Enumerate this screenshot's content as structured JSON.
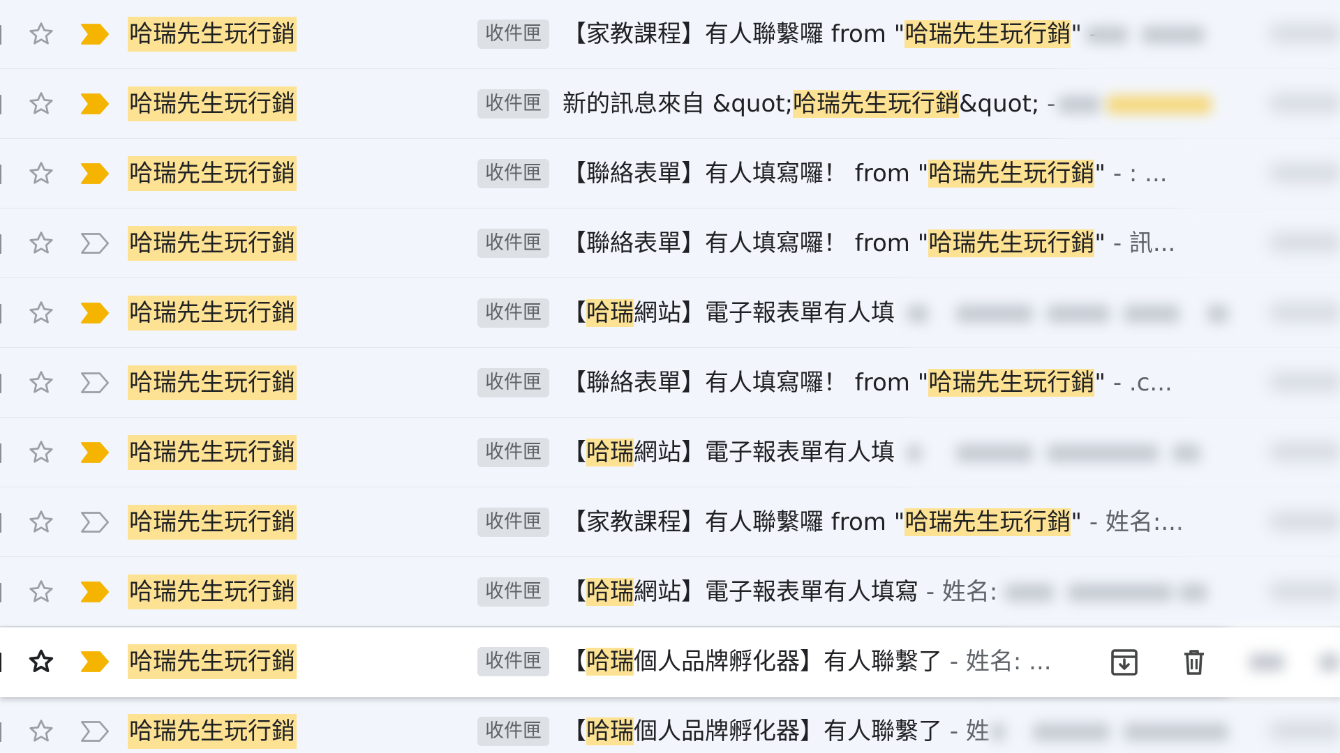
{
  "colors": {
    "highlight": "#fde293",
    "important_marker": "#f4b400",
    "label_chip_bg": "#dde1e6"
  },
  "rows": [
    {
      "sender": "哈瑞先生玩行銷",
      "label": "收件匣",
      "subject_prefix": "【家教課程】有人聯繫囉 from \"",
      "subject_highlight": "哈瑞先生玩行銷",
      "subject_suffix": "\"",
      "snippet": " - ",
      "important": "filled",
      "starred": false
    },
    {
      "sender": "哈瑞先生玩行銷",
      "label": "收件匣",
      "subject_prefix": "新的訊息來自 &quot;",
      "subject_highlight": "哈瑞先生玩行銷",
      "subject_suffix": "&quot;",
      "snippet": " - ",
      "important": "filled",
      "starred": false
    },
    {
      "sender": "哈瑞先生玩行銷",
      "label": "收件匣",
      "subject_prefix": "【聯絡表單】有人填寫囉！ from \"",
      "subject_highlight": "哈瑞先生玩行銷",
      "subject_suffix": "\"",
      "snippet": " - : ...",
      "important": "filled",
      "starred": false
    },
    {
      "sender": "哈瑞先生玩行銷",
      "label": "收件匣",
      "subject_prefix": "【聯絡表單】有人填寫囉！ from \"",
      "subject_highlight": "哈瑞先生玩行銷",
      "subject_suffix": "\"",
      "snippet": " - 訊...",
      "important": "outline",
      "starred": false
    },
    {
      "sender": "哈瑞先生玩行銷",
      "label": "收件匣",
      "subject_prefix": "【",
      "subject_highlight": "哈瑞",
      "subject_suffix": "網站】電子報表單有人填",
      "snippet": "",
      "important": "filled",
      "starred": false
    },
    {
      "sender": "哈瑞先生玩行銷",
      "label": "收件匣",
      "subject_prefix": "【聯絡表單】有人填寫囉！ from \"",
      "subject_highlight": "哈瑞先生玩行銷",
      "subject_suffix": "\"",
      "snippet": " - .c...",
      "important": "outline",
      "starred": false
    },
    {
      "sender": "哈瑞先生玩行銷",
      "label": "收件匣",
      "subject_prefix": "【",
      "subject_highlight": "哈瑞",
      "subject_suffix": "網站】電子報表單有人填",
      "snippet": "",
      "important": "filled",
      "starred": false
    },
    {
      "sender": "哈瑞先生玩行銷",
      "label": "收件匣",
      "subject_prefix": "【家教課程】有人聯繫囉 from \"",
      "subject_highlight": "哈瑞先生玩行銷",
      "subject_suffix": "\"",
      "snippet": " - 姓名:...",
      "important": "outline",
      "starred": false
    },
    {
      "sender": "哈瑞先生玩行銷",
      "label": "收件匣",
      "subject_prefix": "【",
      "subject_highlight": "哈瑞",
      "subject_suffix": "網站】電子報表單有人填寫",
      "snippet": " - 姓名:",
      "important": "filled",
      "starred": false
    },
    {
      "sender": "哈瑞先生玩行銷",
      "label": "收件匣",
      "subject_prefix": "【",
      "subject_highlight": "哈瑞",
      "subject_suffix": "個人品牌孵化器】有人聯繫了",
      "snippet": " - 姓名: ...",
      "important": "filled",
      "starred": false,
      "hovered": true
    },
    {
      "sender": "哈瑞先生玩行銷",
      "label": "收件匣",
      "subject_prefix": "【",
      "subject_highlight": "哈瑞",
      "subject_suffix": "個人品牌孵化器】有人聯繫了",
      "snippet": " - 姓",
      "important": "outline",
      "starred": false
    }
  ],
  "hover_actions": {
    "archive_icon": "archive-icon",
    "delete_icon": "trash-icon"
  }
}
